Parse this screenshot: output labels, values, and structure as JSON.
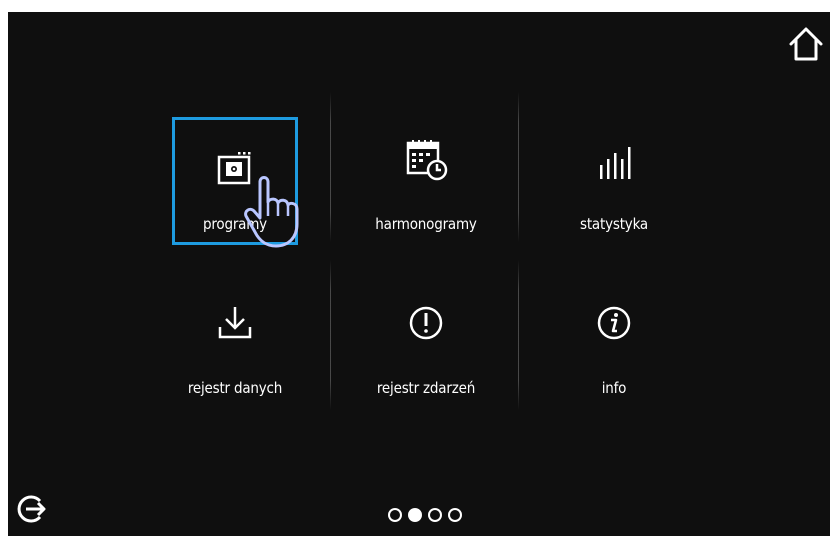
{
  "menu": {
    "tiles": [
      {
        "label": "programy",
        "icon": "program-settings-icon",
        "selected": true
      },
      {
        "label": "harmonogramy",
        "icon": "calendar-schedule-icon",
        "selected": false
      },
      {
        "label": "statystyka",
        "icon": "bar-statistics-icon",
        "selected": false
      },
      {
        "label": "rejestr danych",
        "icon": "download-icon",
        "selected": false
      },
      {
        "label": "rejestr zdarzeń",
        "icon": "exclamation-circle-icon",
        "selected": false
      },
      {
        "label": "info",
        "icon": "info-circle-icon",
        "selected": false
      }
    ]
  },
  "pager": {
    "pages": 4,
    "current": 2
  },
  "colors": {
    "background": "#0f0f0f",
    "accent": "#1e9be0",
    "text": "#ffffff",
    "pointer_hand": "#b9c6ff"
  }
}
